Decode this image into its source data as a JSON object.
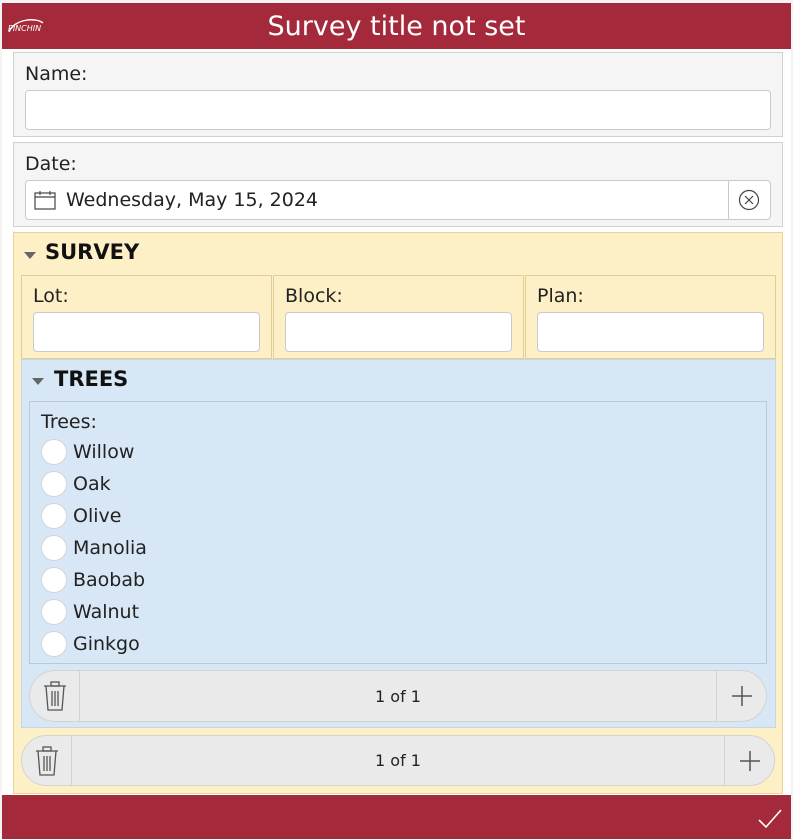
{
  "header": {
    "title": "Survey title not set",
    "logo_text": "PINCHIN"
  },
  "name_field": {
    "label": "Name:",
    "value": ""
  },
  "date_field": {
    "label": "Date:",
    "value": "Wednesday, May 15, 2024"
  },
  "survey_group": {
    "title": "SURVEY",
    "fields": [
      {
        "label": "Lot:",
        "value": ""
      },
      {
        "label": "Block:",
        "value": ""
      },
      {
        "label": "Plan:",
        "value": ""
      }
    ]
  },
  "trees_group": {
    "title": "TREES",
    "question_label": "Trees:",
    "options": [
      "Willow",
      "Oak",
      "Olive",
      "Manolia",
      "Baobab",
      "Walnut",
      "Ginkgo"
    ],
    "pager": {
      "text": "1 of 1"
    }
  },
  "outer_pager": {
    "text": "1 of 1"
  },
  "colors": {
    "brand": "#a4293a",
    "survey_bg": "#fdefc6",
    "trees_bg": "#d8e7f5"
  }
}
